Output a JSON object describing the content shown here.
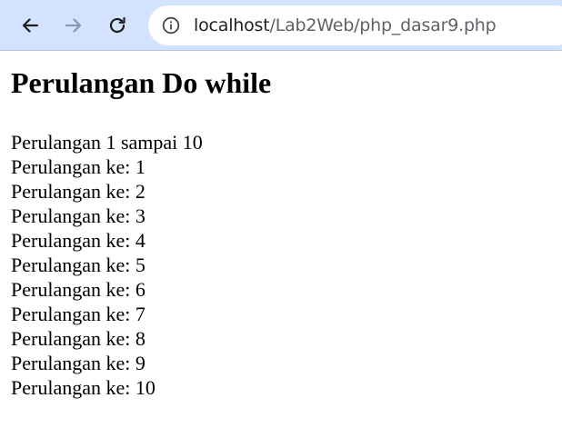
{
  "browser": {
    "url_host": "localhost",
    "url_path": "/Lab2Web/php_dasar9.php",
    "icons": {
      "back": "arrow-left-icon",
      "forward": "arrow-right-icon",
      "reload": "reload-icon",
      "site_info": "info-icon"
    }
  },
  "page": {
    "heading": "Perulangan Do while",
    "intro": "Perulangan 1 sampai 10",
    "items": [
      "Perulangan ke: 1",
      "Perulangan ke: 2",
      "Perulangan ke: 3",
      "Perulangan ke: 4",
      "Perulangan ke: 5",
      "Perulangan ke: 6",
      "Perulangan ke: 7",
      "Perulangan ke: 8",
      "Perulangan ke: 9",
      "Perulangan ke: 10"
    ]
  }
}
